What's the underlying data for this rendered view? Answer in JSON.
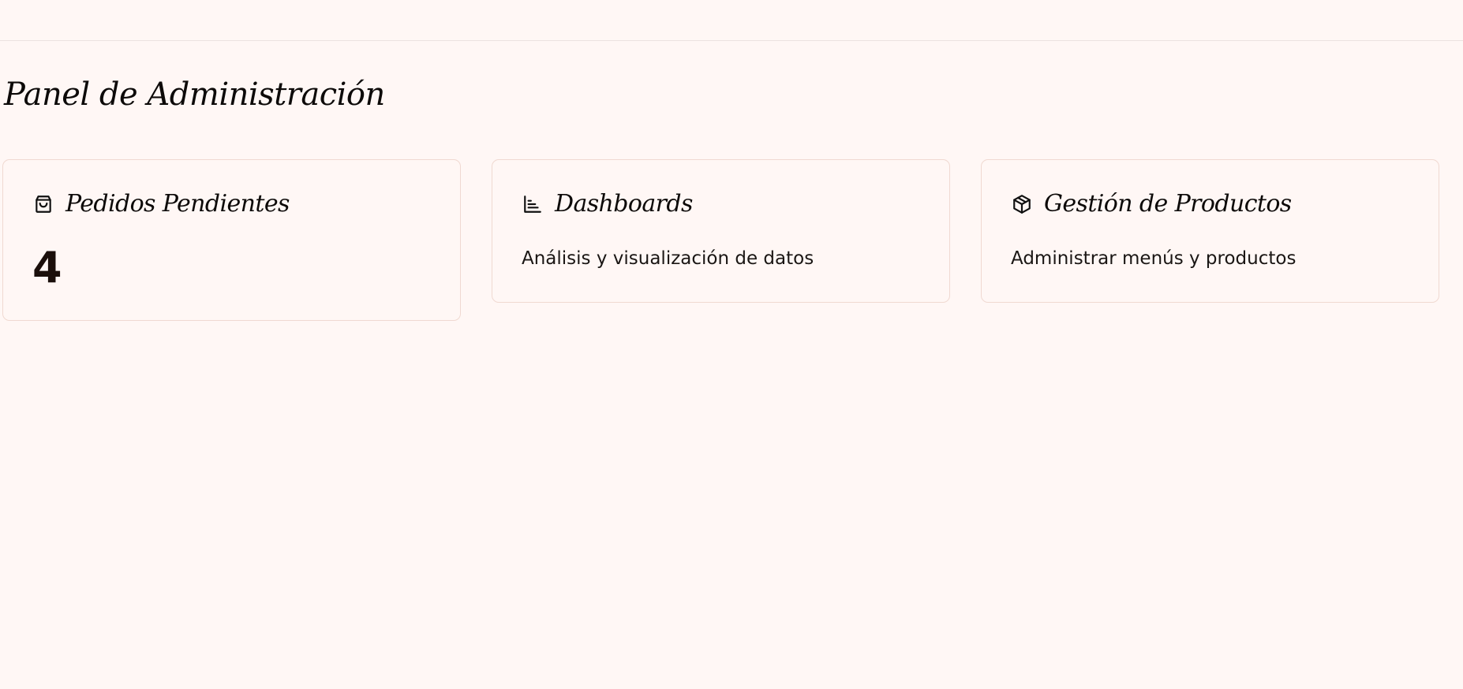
{
  "header": {
    "title": "Panel de Administración"
  },
  "cards": [
    {
      "title": "Pedidos Pendientes",
      "icon": "shopping-bag-icon",
      "value": "4"
    },
    {
      "title": "Dashboards",
      "icon": "bar-chart-icon",
      "description": "Análisis y visualización de datos"
    },
    {
      "title": "Gestión de Productos",
      "icon": "package-icon",
      "description": "Administrar menús y productos"
    }
  ],
  "colors": {
    "background": "#fff7f5",
    "card_border": "#f0d9d1",
    "text": "#0d0a09"
  }
}
